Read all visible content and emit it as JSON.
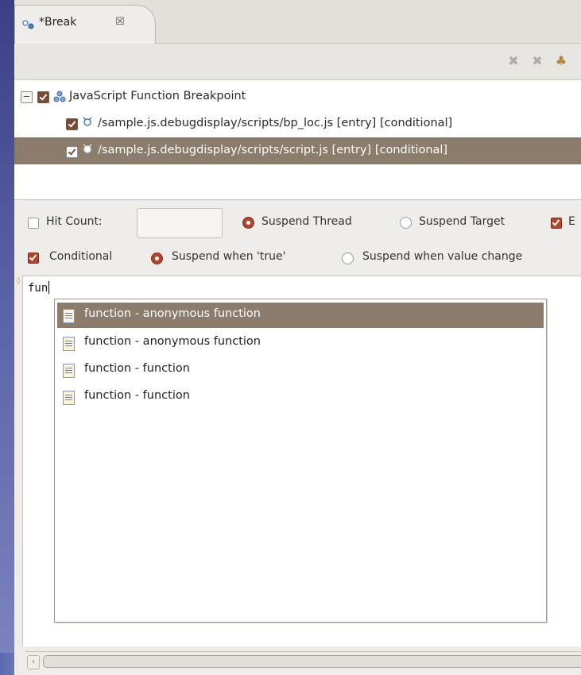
{
  "tab": {
    "title": "*Break",
    "close_glyph": "☒"
  },
  "toolbar": {
    "icons": [
      "remove-icon",
      "remove-all-icon",
      "link-icon"
    ]
  },
  "tree": {
    "root": {
      "label": "JavaScript Function Breakpoint",
      "expander": "−"
    },
    "children": [
      {
        "label": "/sample.js.debugdisplay/scripts/bp_loc.js [entry] [conditional]",
        "checked": true
      },
      {
        "label": "/sample.js.debugdisplay/scripts/script.js [entry] [conditional]",
        "checked": true,
        "selected": true
      }
    ]
  },
  "options": {
    "hit_count_label": "Hit Count:",
    "hit_count_value": "",
    "suspend_thread": "Suspend Thread",
    "suspend_target": "Suspend Target",
    "enabled_label": "E",
    "conditional_label": "Conditional",
    "suspend_true": "Suspend when 'true'",
    "suspend_change": "Suspend when value change"
  },
  "editor": {
    "text": "fun"
  },
  "completions": [
    {
      "label": "function - anonymous function",
      "selected": true
    },
    {
      "label": "function - anonymous function",
      "selected": false
    },
    {
      "label": "function - function",
      "selected": false
    },
    {
      "label": "function - function",
      "selected": false
    }
  ],
  "scrollbar": {
    "left_arrow": "‹"
  },
  "colors": {
    "selection": "#8c7c6b",
    "accent": "#b3452c"
  }
}
